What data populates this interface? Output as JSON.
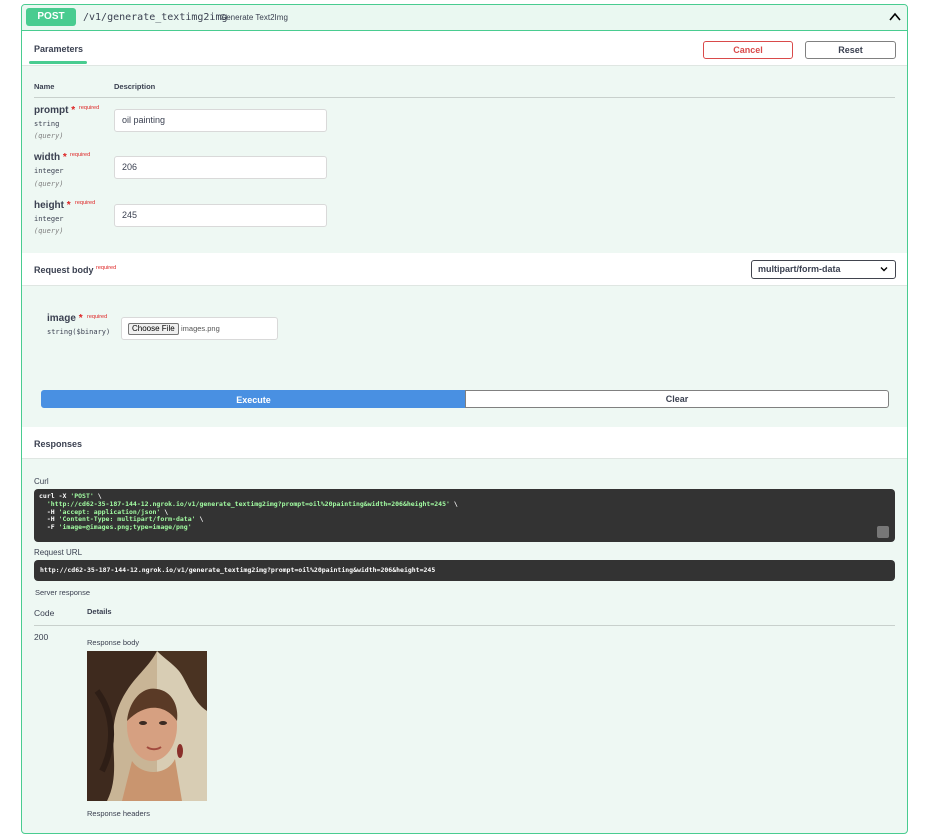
{
  "summary": {
    "method": "POST",
    "path": "/v1/generate_textimg2img",
    "description": "Generate Text2Img",
    "collapse_icon": "chevron-up-icon"
  },
  "parameters": {
    "tab_label": "Parameters",
    "cancel_label": "Cancel",
    "reset_label": "Reset",
    "columns": [
      "Name",
      "Description"
    ],
    "required_marker": "*",
    "required_label": "required",
    "items": [
      {
        "name": "prompt",
        "type": "string",
        "in": "(query)",
        "value": "oil painting"
      },
      {
        "name": "width",
        "type": "integer",
        "in": "(query)",
        "value": "206"
      },
      {
        "name": "height",
        "type": "integer",
        "in": "(query)",
        "value": "245"
      }
    ]
  },
  "request_body": {
    "title": "Request body",
    "required_label": "required",
    "content_type": "multipart/form-data",
    "field": {
      "name": "image",
      "type": "string($binary)",
      "button": "Choose File",
      "file": "images.png"
    }
  },
  "actions": {
    "execute_label": "Execute",
    "clear_label": "Clear"
  },
  "responses": {
    "title": "Responses",
    "curl_label": "Curl",
    "curl_lines": [
      {
        "cmd": "curl -X ",
        "str": "'POST'",
        "tail": " \\"
      },
      {
        "cmd": "  ",
        "str": "'http://cd62-35-187-144-12.ngrok.io/v1/generate_textimg2img?prompt=oil%20painting&width=206&height=245'",
        "tail": " \\"
      },
      {
        "cmd": "  -H ",
        "str": "'accept: application/json'",
        "tail": " \\"
      },
      {
        "cmd": "  -H ",
        "str": "'Content-Type: multipart/form-data'",
        "tail": " \\"
      },
      {
        "cmd": "  -F ",
        "str": "'image=@images.png;type=image/png'",
        "tail": ""
      }
    ],
    "request_url_label": "Request URL",
    "request_url": "http://cd62-35-187-144-12.ngrok.io/v1/generate_textimg2img?prompt=oil%20painting&width=206&height=245",
    "server_response_label": "Server response",
    "code_header": "Code",
    "details_header": "Details",
    "code": "200",
    "response_body_label": "Response body",
    "response_headers_label": "Response headers",
    "copy_icon": "clipboard-icon"
  }
}
